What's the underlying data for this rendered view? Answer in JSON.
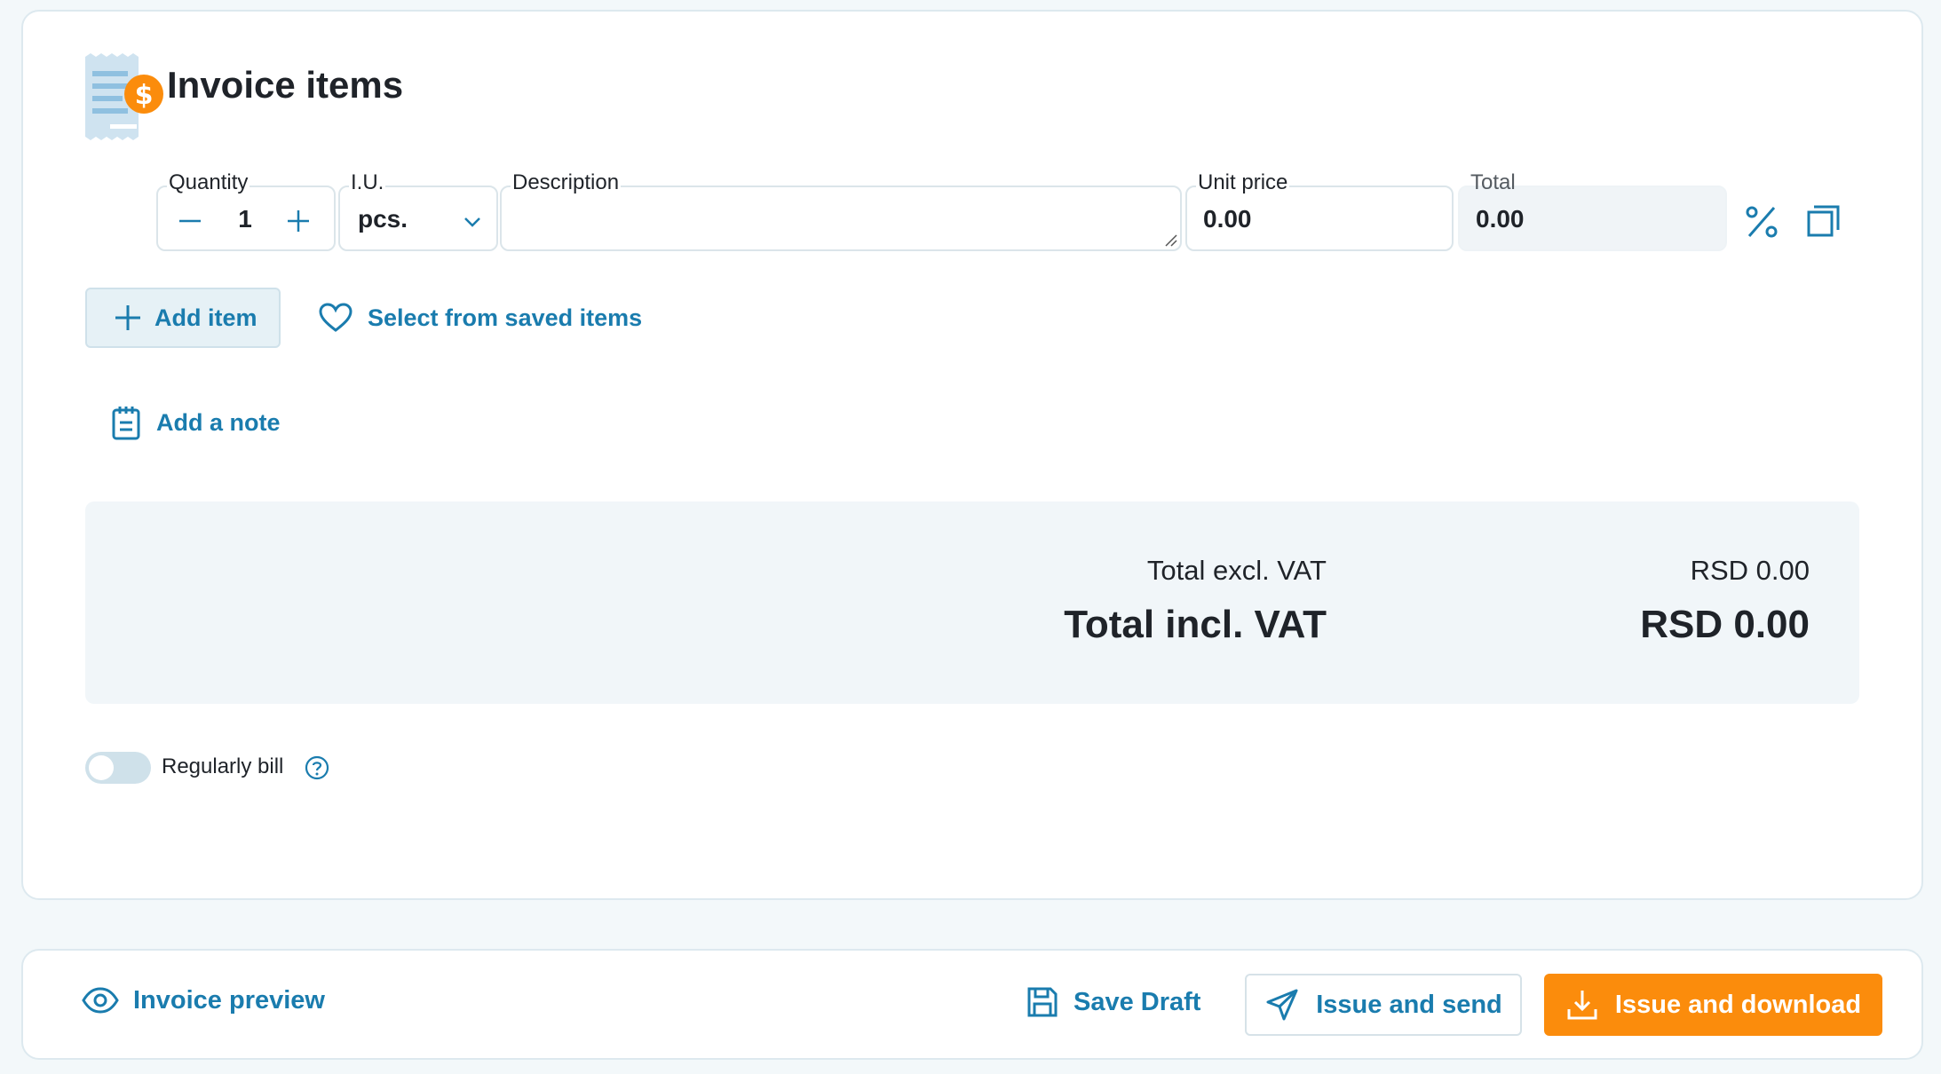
{
  "section": {
    "title": "Invoice items",
    "icon": "invoice-dollar-icon"
  },
  "item_row": {
    "quantity": {
      "label": "Quantity",
      "value": "1"
    },
    "unit": {
      "label": "I.U.",
      "value": "pcs."
    },
    "description": {
      "label": "Description",
      "value": ""
    },
    "unit_price": {
      "label": "Unit price",
      "value": "0.00"
    },
    "total": {
      "label": "Total",
      "value": "0.00"
    }
  },
  "actions": {
    "add_item": "Add item",
    "saved_items": "Select from saved items",
    "add_note": "Add a note"
  },
  "totals": {
    "excl_label": "Total excl. VAT",
    "excl_value": "RSD 0.00",
    "incl_label": "Total incl. VAT",
    "incl_value": "RSD 0.00"
  },
  "recurring": {
    "label": "Regularly bill",
    "enabled": false
  },
  "footer": {
    "preview": "Invoice preview",
    "save_draft": "Save Draft",
    "issue_send": "Issue and send",
    "issue_download": "Issue and download"
  },
  "colors": {
    "accent": "#1a7cae",
    "primary": "#fb8c0c",
    "background": "#f3f8fa"
  }
}
